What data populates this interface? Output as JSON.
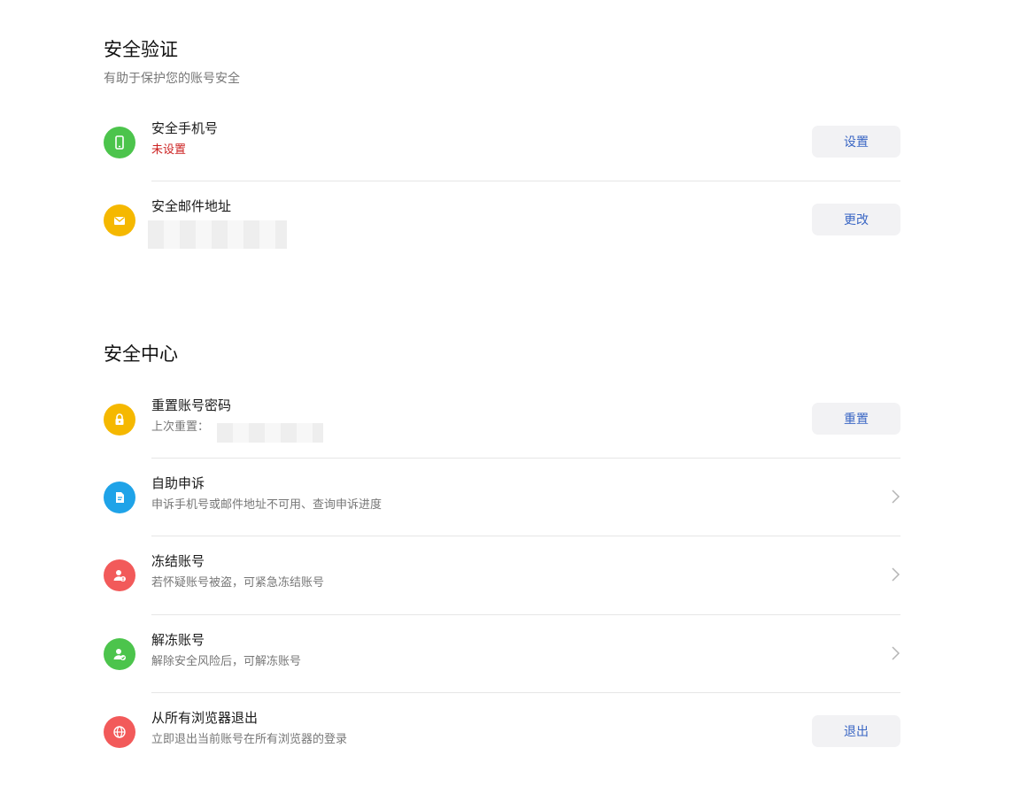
{
  "verify": {
    "title": "安全验证",
    "subtitle": "有助于保护您的账号安全",
    "items": [
      {
        "title": "安全手机号",
        "desc": "未设置",
        "button": "设置",
        "icon": "phone-icon",
        "color": "#4cc44c"
      },
      {
        "title": "安全邮件地址",
        "desc": "",
        "button": "更改",
        "icon": "mail-icon",
        "color": "#f5b800"
      }
    ]
  },
  "center": {
    "title": "安全中心",
    "items": [
      {
        "title": "重置账号密码",
        "desc": "上次重置：",
        "button": "重置",
        "icon": "lock-icon",
        "color": "#f5b800"
      },
      {
        "title": "自助申诉",
        "desc": "申诉手机号或邮件地址不可用、查询申诉进度",
        "icon": "document-icon",
        "color": "#1fa3e8"
      },
      {
        "title": "冻结账号",
        "desc": "若怀疑账号被盗，可紧急冻结账号",
        "icon": "user-alert-icon",
        "color": "#f25a5a"
      },
      {
        "title": "解冻账号",
        "desc": "解除安全风险后，可解冻账号",
        "icon": "user-check-icon",
        "color": "#4cc44c"
      },
      {
        "title": "从所有浏览器退出",
        "desc": "立即退出当前账号在所有浏览器的登录",
        "button": "退出",
        "icon": "globe-icon",
        "color": "#f25a5a"
      }
    ]
  }
}
